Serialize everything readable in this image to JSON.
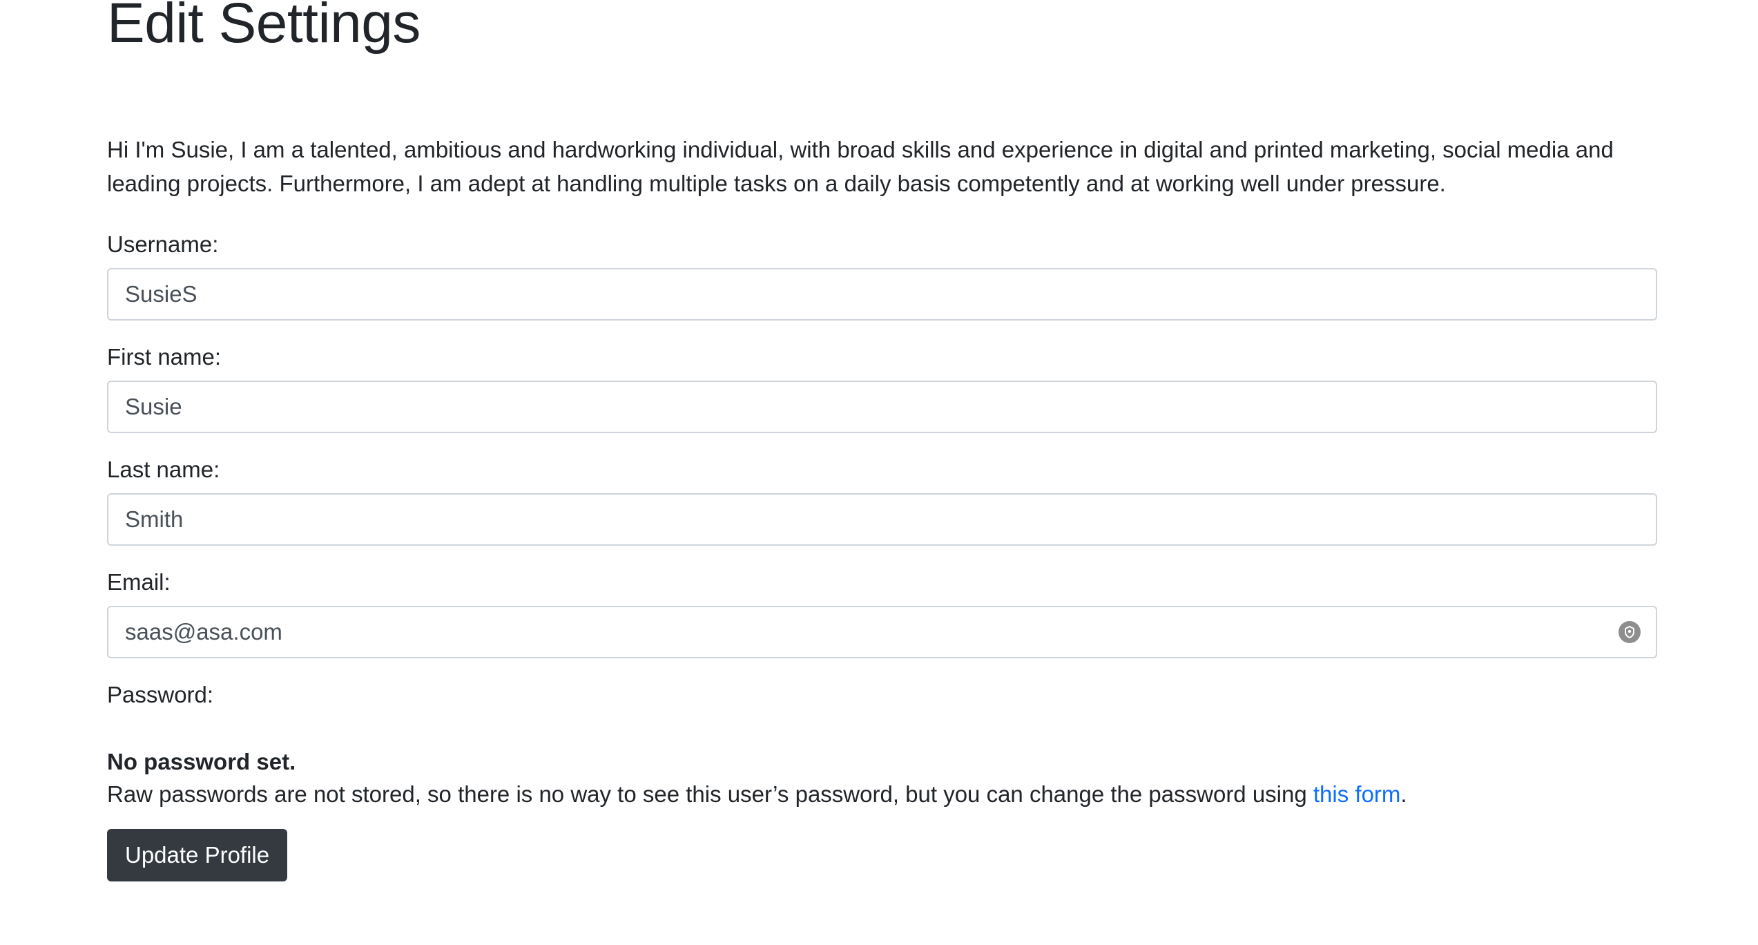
{
  "page": {
    "title": "Edit Settings",
    "intro": "Hi I'm Susie, I am a talented, ambitious and hardworking individual, with broad skills and experience in digital and printed marketing, social media and leading projects. Furthermore, I am adept at handling multiple tasks on a daily basis competently and at working well under pressure."
  },
  "form": {
    "username": {
      "label": "Username:",
      "value": "SusieS"
    },
    "first_name": {
      "label": "First name:",
      "value": "Susie"
    },
    "last_name": {
      "label": "Last name:",
      "value": "Smith"
    },
    "email": {
      "label": "Email:",
      "value": "saas@asa.com",
      "icon": "autofill-key-icon"
    },
    "password": {
      "label": "Password:",
      "status": "No password set.",
      "help_prefix": "Raw passwords are not stored, so there is no way to see this user’s password, but you can change the password using ",
      "help_link": "this form",
      "help_suffix": "."
    },
    "submit_label": "Update Profile"
  },
  "colors": {
    "button_bg": "#343a40",
    "link": "#0d6efd",
    "input_border": "#ced4da"
  }
}
